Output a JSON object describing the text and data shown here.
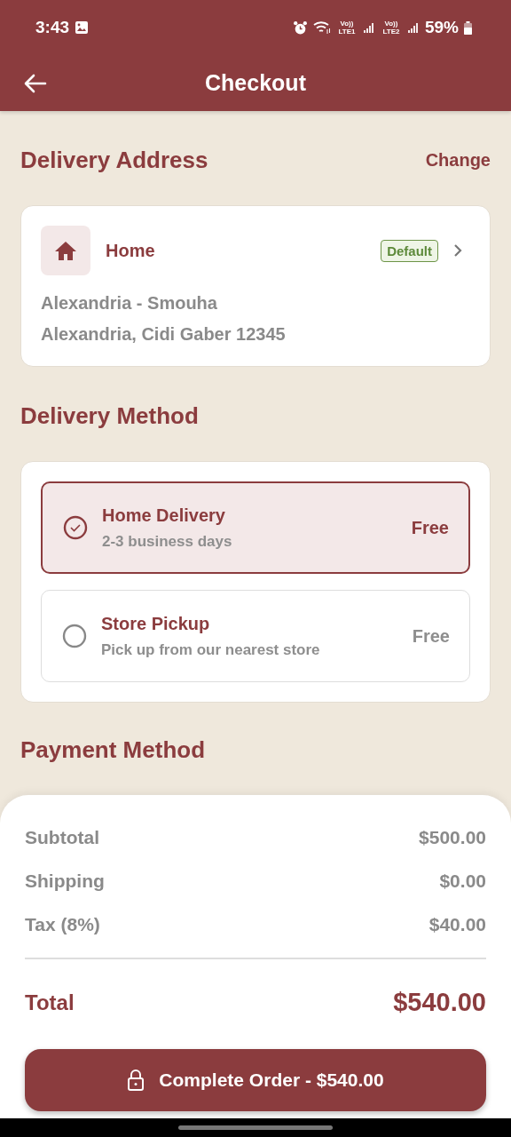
{
  "status_bar": {
    "time": "3:43",
    "sim1": "Vo)) LTE1",
    "sim2": "Vo)) LTE2",
    "battery": "59%"
  },
  "app_bar": {
    "title": "Checkout"
  },
  "delivery_address": {
    "title": "Delivery Address",
    "action": "Change",
    "address": {
      "label": "Home",
      "badge": "Default",
      "line_1": "Alexandria - Smouha",
      "line_2": "Alexandria, Cidi Gaber 12345"
    }
  },
  "delivery_method": {
    "title": "Delivery Method",
    "options": [
      {
        "name": "Home Delivery",
        "detail": "2-3 business days",
        "price": "Free",
        "selected": true
      },
      {
        "name": "Store Pickup",
        "detail": "Pick up from our nearest store",
        "price": "Free",
        "selected": false
      }
    ]
  },
  "payment_method": {
    "title": "Payment Method"
  },
  "summary": {
    "rows": [
      {
        "label": "Subtotal",
        "value": "$500.00"
      },
      {
        "label": "Shipping",
        "value": "$0.00"
      },
      {
        "label": "Tax (8%)",
        "value": "$40.00"
      }
    ],
    "total": {
      "label": "Total",
      "value": "$540.00"
    },
    "button": "Complete Order - $540.00"
  }
}
